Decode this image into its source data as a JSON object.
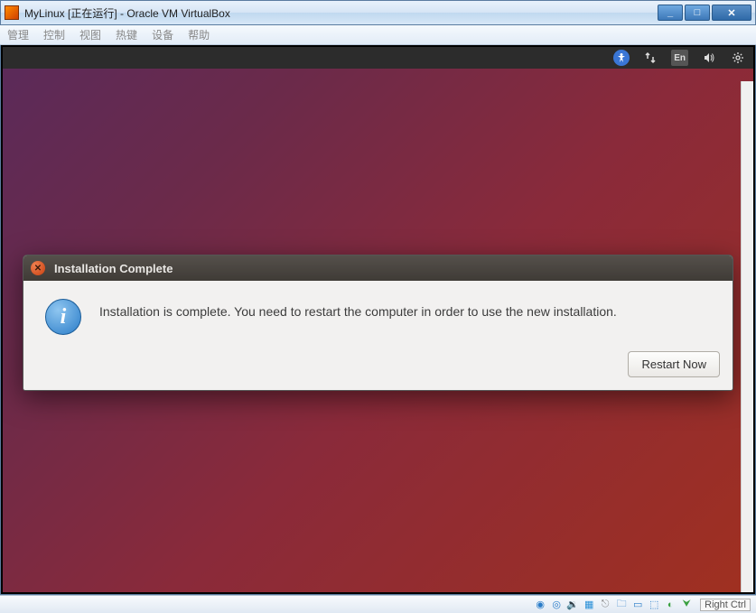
{
  "window": {
    "title": "MyLinux [正在运行] - Oracle VM VirtualBox",
    "min_tip": "_",
    "max_tip": "□",
    "close_tip": "✕"
  },
  "menu": {
    "items": [
      "管理",
      "控制",
      "视图",
      "热键",
      "设备",
      "帮助"
    ]
  },
  "panel": {
    "lang": "En"
  },
  "dialog": {
    "title": "Installation Complete",
    "close_glyph": "✕",
    "info_glyph": "i",
    "message": "Installation is complete. You need to restart the computer in order to use the new installation.",
    "restart_label": "Restart Now"
  },
  "status": {
    "host_key": "Right Ctrl"
  }
}
